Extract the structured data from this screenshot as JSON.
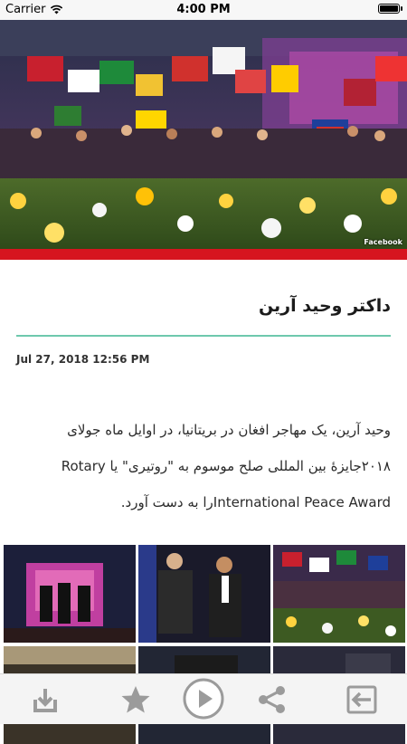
{
  "status_bar": {
    "carrier": "Carrier",
    "time": "4:00 PM"
  },
  "hero": {
    "credit": "Facebook"
  },
  "article": {
    "title": "داکتر وحید آرین",
    "date": "Jul 27, 2018 12:56 PM",
    "body_lines": [
      "وحید آرین، یک مهاجر افغان در بریتانیا، در اوایل ماه جولای",
      "۲۰۱۸جایزهٔ بین المللی صلح موسوم به \"روتیری\" یا Rotary",
      "International Peace Awardرا به دست آورد."
    ]
  },
  "gallery": {
    "thumb_count": 6
  },
  "toolbar": {
    "icons": [
      "download-icon",
      "star-icon",
      "play-icon",
      "share-icon",
      "back-arrow-icon"
    ]
  },
  "colors": {
    "accent_red": "#d6141f",
    "divider_green": "#6ec8ad",
    "toolbar_icon": "#9b9b9b"
  }
}
